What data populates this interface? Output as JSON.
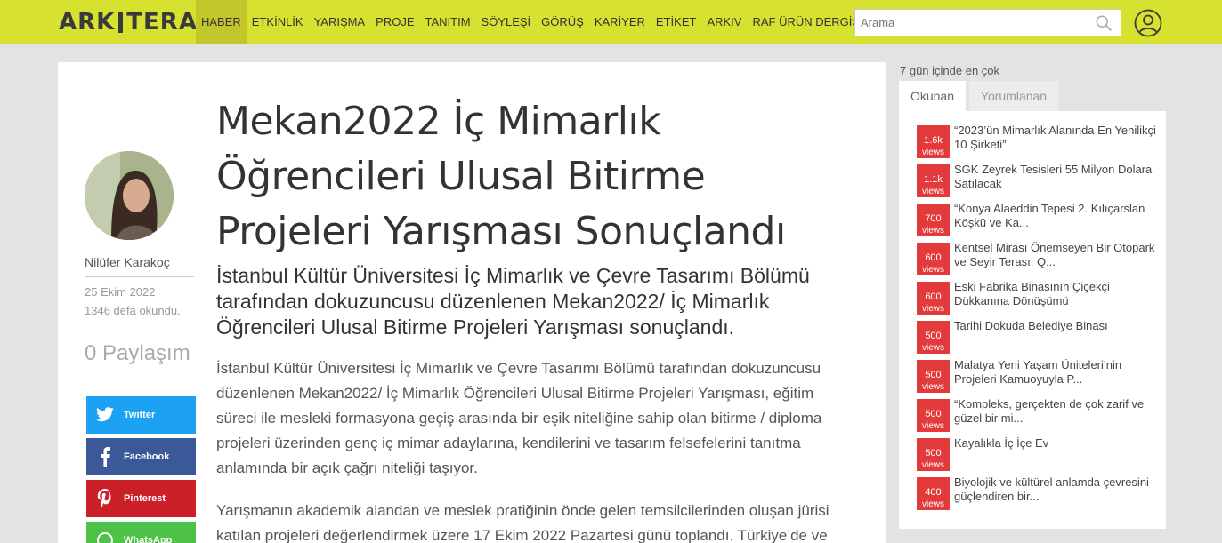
{
  "header": {
    "logo_left": "ARK",
    "logo_right": "TERA",
    "nav": [
      "HABER",
      "ETKİNLİK",
      "YARIŞMA",
      "PROJE",
      "TANITIM",
      "SÖYLEŞİ",
      "GÖRÜŞ",
      "KARİYER",
      "ETİKET",
      "ARKIV",
      "RAF ÜRÜN DERGİSİ"
    ],
    "active_nav": "HABER",
    "search_placeholder": "Arama",
    "accent_color": "#d7e12f"
  },
  "article": {
    "title": "Mekan2022 İç Mimarlık Öğrencileri Ulusal Bitirme Projeleri Yarışması Sonuçlandı",
    "lead": "İstanbul Kültür Üniversitesi İç Mimarlık ve Çevre Tasarımı Bölümü tarafından dokuzuncusu düzenlenen Mekan2022/ İç Mimarlık Öğrencileri Ulusal Bitirme Projeleri Yarışması sonuçlandı.",
    "paragraph1": "İstanbul Kültür Üniversitesi İç Mimarlık ve Çevre Tasarımı Bölümü tarafından dokuzuncusu düzenlenen Mekan2022/ İç Mimarlık Öğrencileri Ulusal Bitirme Projeleri Yarışması, eğitim süreci ile mesleki formasyona geçiş arasında bir eşik niteliğine sahip olan bitirme / diploma projeleri üzerinden genç iç mimar adaylarına, kendilerini ve tasarım felsefelerini tanıtma anlamında bir açık çağrı niteliği taşıyor.",
    "paragraph2": "Yarışmanın akademik alandan ve meslek pratiğinin önde gelen temsilcilerinden oluşan jürisi katılan projeleri değerlendirmek üzere 17 Ekim 2022 Pazartesi günü toplandı. Türkiye’de ve"
  },
  "author": {
    "name": "Nilüfer Karakoç",
    "date": "25 Ekim 2022",
    "reads": "1346 defa okundu.",
    "shares": "0 Paylaşım"
  },
  "share_buttons": {
    "twitter": "Twitter",
    "facebook": "Facebook",
    "pinterest": "Pinterest",
    "whatsapp": "WhatsApp"
  },
  "sidebar": {
    "title": "7 gün içinde en çok",
    "tab_active": "Okunan",
    "tab_inactive": "Yorumlanan",
    "views_label": "views",
    "items": [
      {
        "views": "1.6k",
        "text": "“2023’ün Mimarlık Alanında En Yenilikçi 10 Şirketi”"
      },
      {
        "views": "1.1k",
        "text": "SGK Zeyrek Tesisleri 55 Milyon Dolara Satılacak"
      },
      {
        "views": "700",
        "text": "“Konya Alaeddin Tepesi 2. Kılıçarslan Köşkü ve Ka..."
      },
      {
        "views": "600",
        "text": "Kentsel Mirası Önemseyen Bir Otopark ve Seyir Terası: Q..."
      },
      {
        "views": "600",
        "text": "Eski Fabrika Binasının Çiçekçi Dükkanına Dönüşümü"
      },
      {
        "views": "500",
        "text": "Tarihi Dokuda Belediye Binası"
      },
      {
        "views": "500",
        "text": "Malatya Yeni Yaşam Üniteleri’nin Projeleri Kamuoyuyla P..."
      },
      {
        "views": "500",
        "text": "“Kompleks, gerçekten de çok zarif ve güzel bir mi..."
      },
      {
        "views": "500",
        "text": "Kayalıkla İç İçe Ev"
      },
      {
        "views": "400",
        "text": "Biyolojik ve kültürel anlamda çevresini güçlendiren bir..."
      }
    ]
  }
}
